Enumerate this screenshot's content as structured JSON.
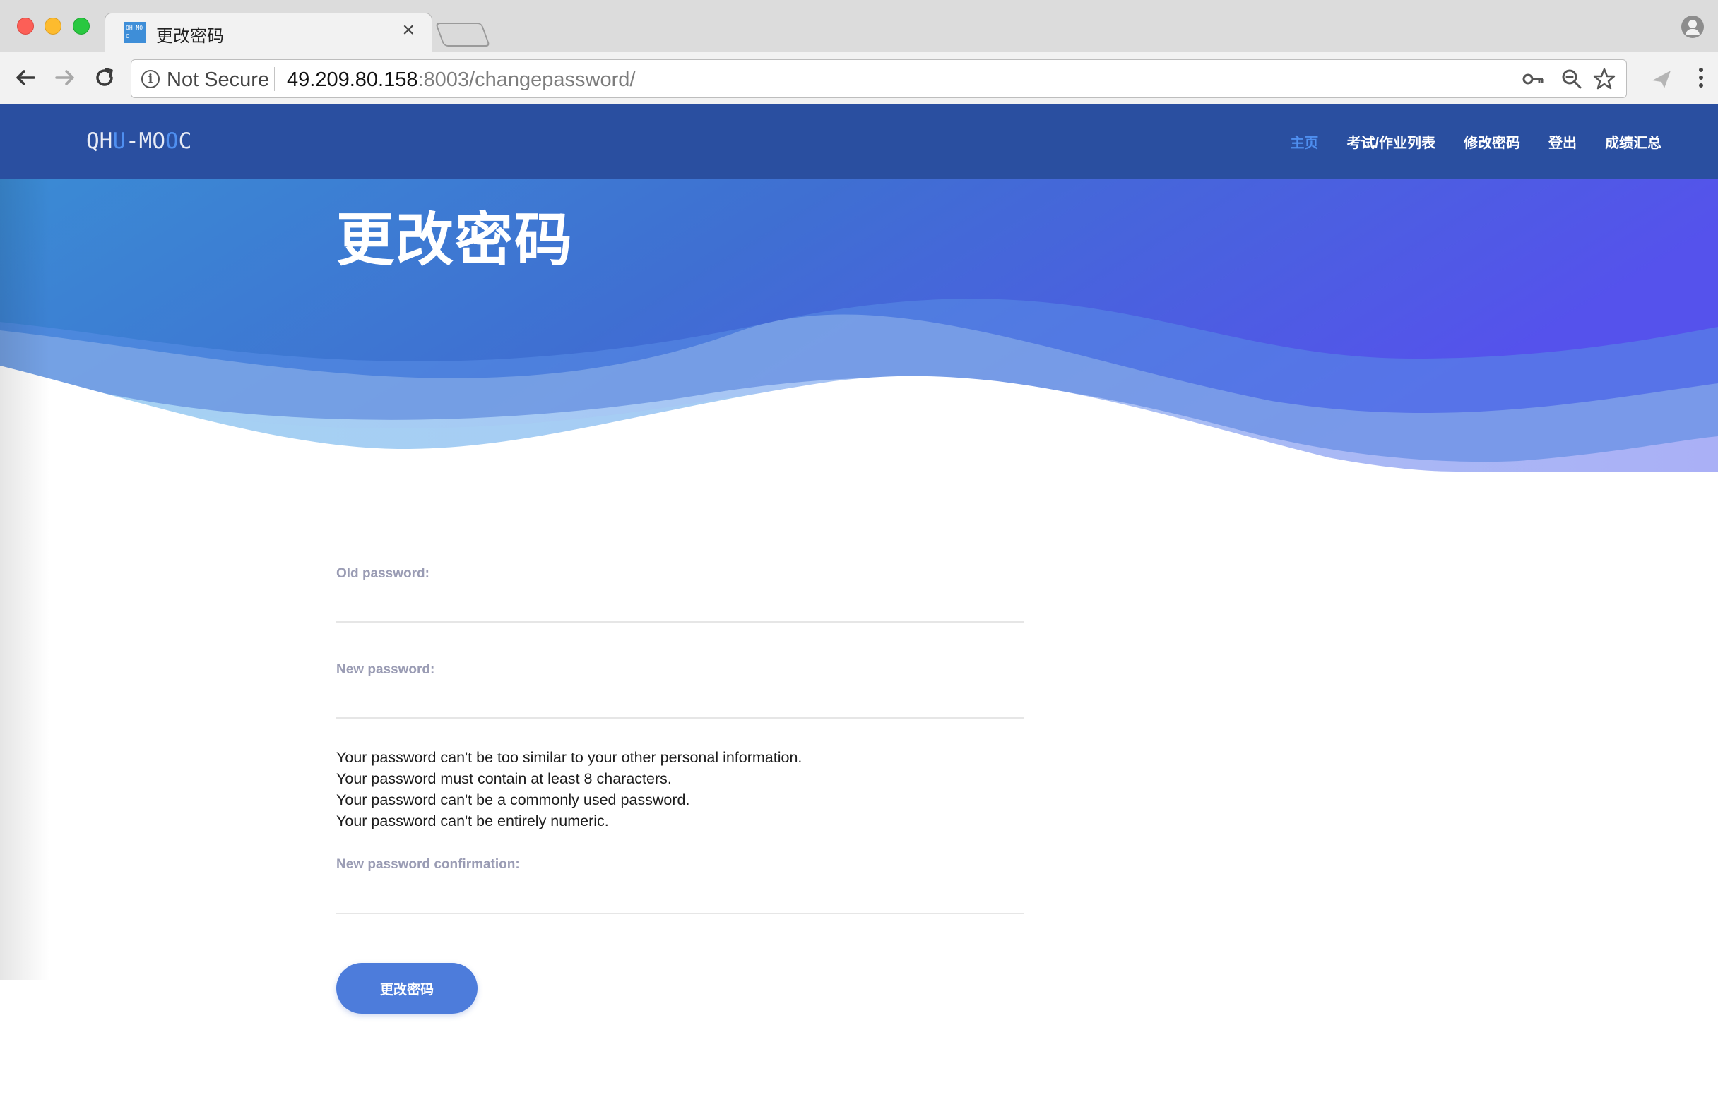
{
  "browser": {
    "tab_title": "更改密码",
    "favicon_text": "QH MO C",
    "close_glyph": "×",
    "security_label": "Not Secure",
    "url_host": "49.209.80.158",
    "url_rest": ":8003/changepassword/",
    "icons": {
      "back": "back-arrow-icon",
      "forward": "forward-arrow-icon",
      "reload": "reload-icon",
      "info": "info-icon",
      "key": "key-icon",
      "zoom": "zoom-out-icon",
      "star": "bookmark-star-icon",
      "extension": "extension-icon",
      "menu": "kebab-menu-icon",
      "profile": "profile-icon"
    }
  },
  "site": {
    "logo_parts": [
      "QH",
      "U",
      "-MO",
      "O",
      "C"
    ],
    "nav": [
      {
        "label": "主页",
        "active": true
      },
      {
        "label": "考试/作业列表",
        "active": false
      },
      {
        "label": "修改密码",
        "active": false
      },
      {
        "label": "登出",
        "active": false
      },
      {
        "label": "成绩汇总",
        "active": false
      }
    ],
    "colors": {
      "nav_bg": "#2a4fa0",
      "accent": "#4f8ff0",
      "button": "#4d7cdb"
    }
  },
  "page": {
    "title": "更改密码"
  },
  "form": {
    "old_password_label": "Old password:",
    "old_password_value": "",
    "new_password_label": "New password:",
    "new_password_value": "",
    "help": [
      "Your password can't be too similar to your other personal information.",
      "Your password must contain at least 8 characters.",
      "Your password can't be a commonly used password.",
      "Your password can't be entirely numeric."
    ],
    "confirm_label": "New password confirmation:",
    "confirm_value": "",
    "submit_label": "更改密码"
  }
}
